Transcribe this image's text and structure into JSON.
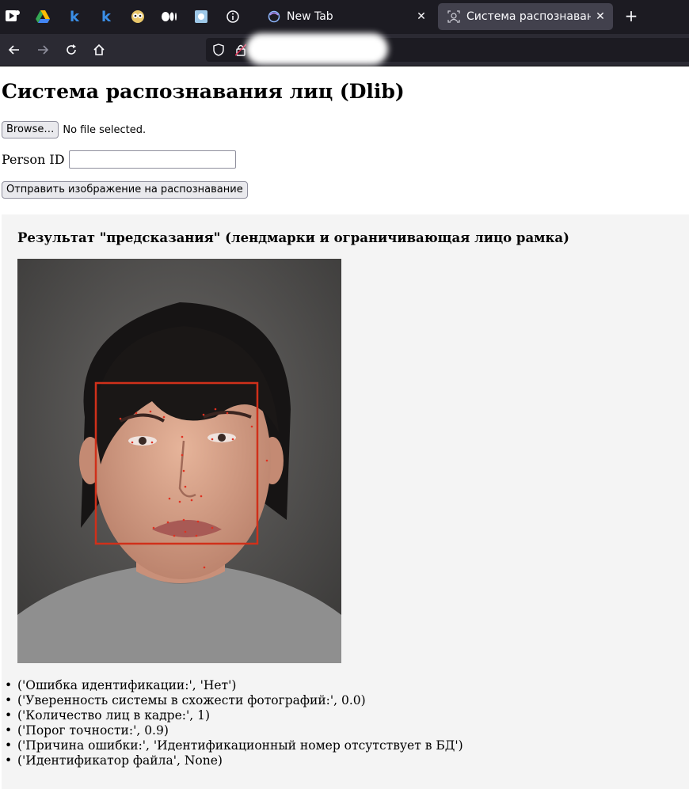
{
  "tabs": [
    {
      "label": "New Tab",
      "icon": "firefox-icon",
      "active": false
    },
    {
      "label": "Система распознавания",
      "icon": "face-recognition-icon",
      "active": true
    }
  ],
  "pinned_icons": [
    "video-app-icon",
    "google-drive-icon",
    "k-icon",
    "k-icon",
    "owl-icon",
    "medium-icon",
    "image-app-icon",
    "info-icon"
  ],
  "page": {
    "title": "Система распознавания лиц (Dlib)",
    "browse_label": "Browse…",
    "no_file_text": "No file selected.",
    "person_id_label": "Person ID",
    "person_id_value": "",
    "submit_label": "Отправить изображение на распознавание"
  },
  "result": {
    "heading": "Результат \"предсказания\" (лендмарки и ограничивающая лицо рамка)",
    "items": [
      "('Ошибка идентификации:', 'Нет')",
      "('Уверенность системы в схожести фотографий:', 0.0)",
      "('Количество лиц в кадре:', 1)",
      "('Порог точности:', 0.9)",
      "('Причина ошибки:', 'Идентификационный номер отсутствует в БД')",
      "('Идентификатор файла', None)"
    ],
    "box_color": "#d0301a",
    "landmark_color": "#e03020"
  }
}
